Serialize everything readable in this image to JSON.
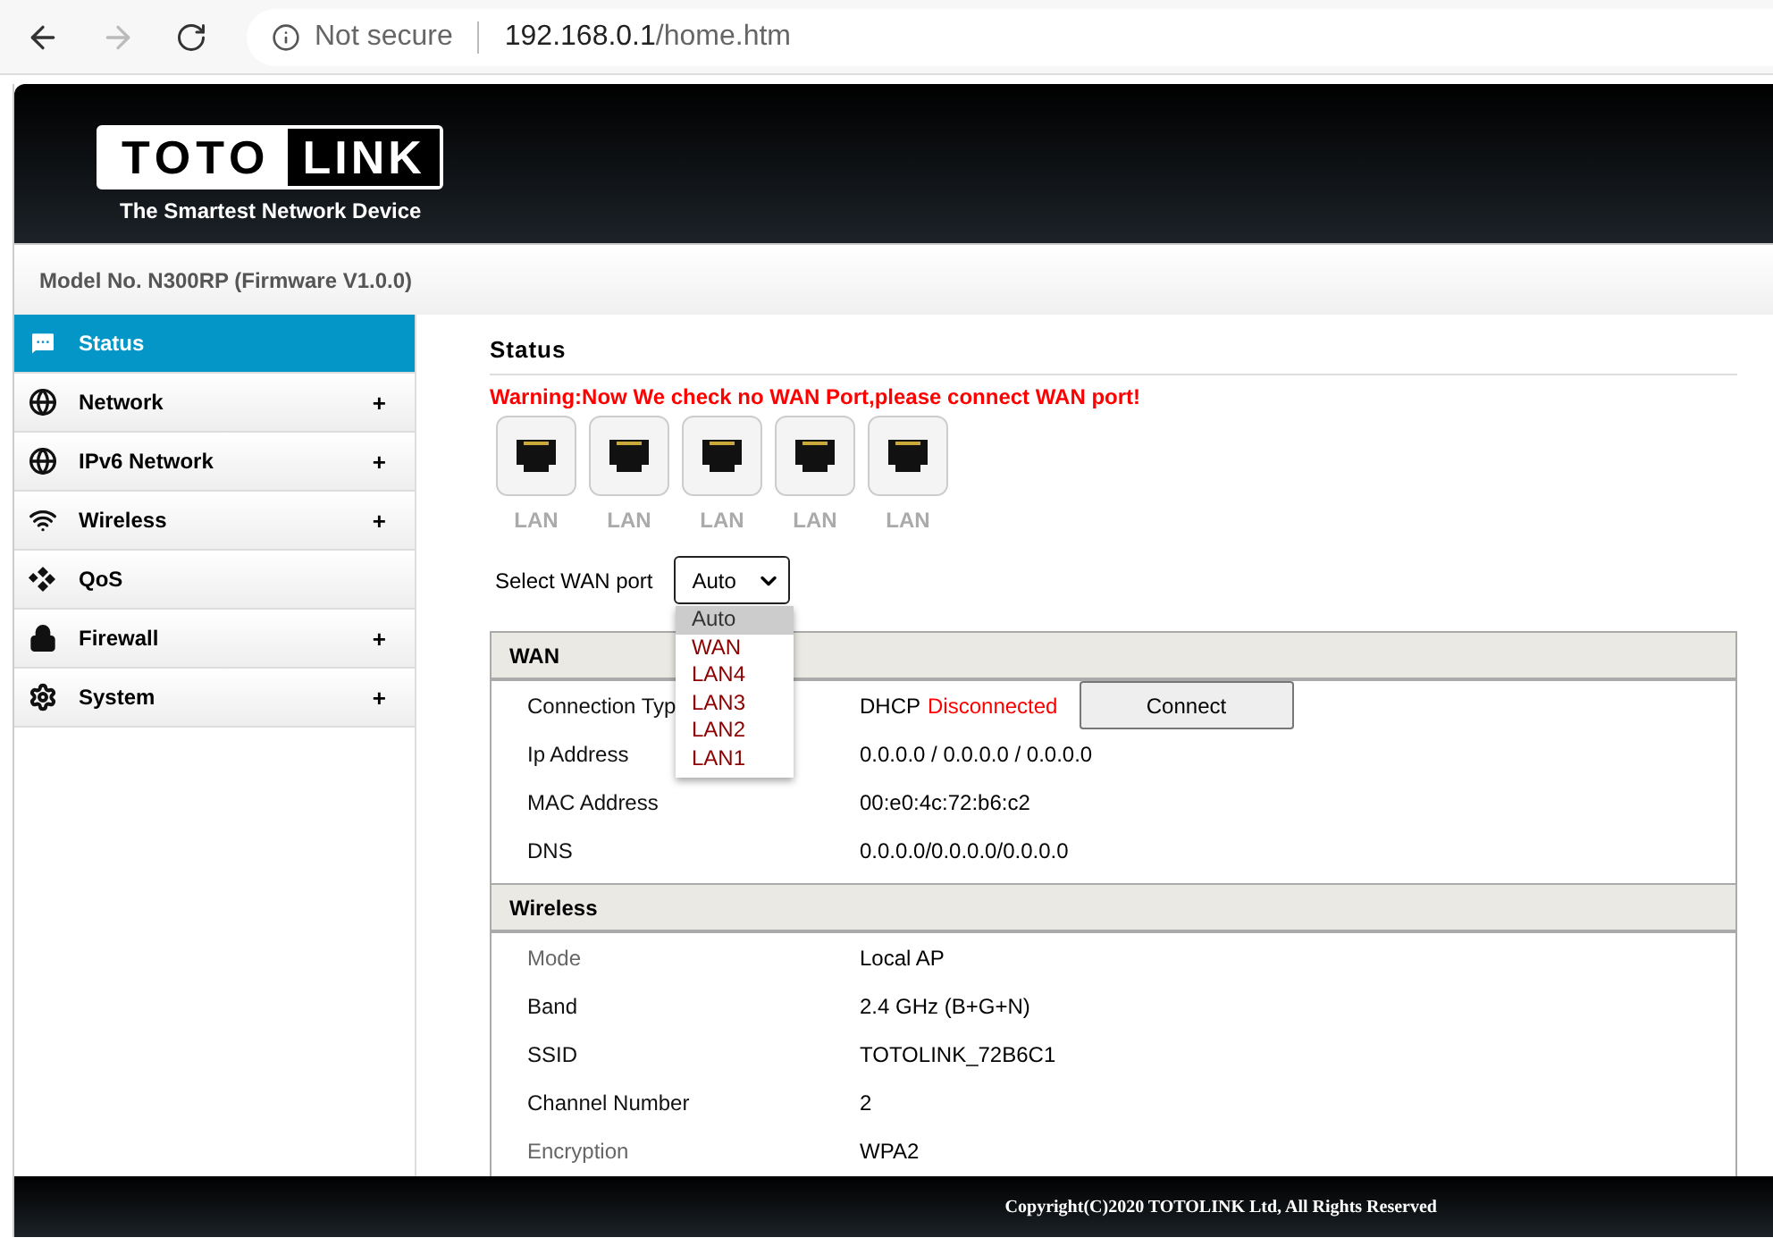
{
  "browser": {
    "security": "Not secure",
    "host": "192.168.0.1",
    "path": "/home.htm"
  },
  "header": {
    "logo_left": "TOTO",
    "logo_right": "LINK",
    "tagline": "The Smartest Network Device",
    "model": "Model No. N300RP (Firmware V1.0.0)"
  },
  "sidebar": {
    "items": [
      {
        "label": "Status",
        "kind": "chat",
        "selected": true
      },
      {
        "label": "Network",
        "kind": "globe",
        "expander": "+",
        "selected": false
      },
      {
        "label": "IPv6 Network",
        "kind": "globe",
        "expander": "+",
        "selected": false
      },
      {
        "label": "Wireless",
        "kind": "wifi",
        "expander": "+",
        "selected": false
      },
      {
        "label": "QoS",
        "kind": "qos",
        "selected": false
      },
      {
        "label": "Firewall",
        "kind": "lock",
        "expander": "+",
        "selected": false
      },
      {
        "label": "System",
        "kind": "gear",
        "expander": "+",
        "selected": false
      }
    ]
  },
  "content": {
    "title": "Status",
    "warning": "Warning:Now We check no WAN Port,please connect WAN port!",
    "ports": [
      {
        "label": "LAN"
      },
      {
        "label": "LAN"
      },
      {
        "label": "LAN"
      },
      {
        "label": "LAN"
      },
      {
        "label": "LAN"
      }
    ],
    "wan_select": {
      "label": "Select WAN port",
      "value": "Auto",
      "expanded": true,
      "options": [
        {
          "label": "Auto",
          "selected": true
        },
        {
          "label": "WAN",
          "selected": false
        },
        {
          "label": "LAN4",
          "selected": false
        },
        {
          "label": "LAN3",
          "selected": false
        },
        {
          "label": "LAN2",
          "selected": false
        },
        {
          "label": "LAN1",
          "selected": false
        }
      ]
    },
    "sections": [
      {
        "title": "WAN",
        "rows": [
          {
            "label": "Connection Typ",
            "value": "DHCP",
            "status": "Disconnected",
            "button": "Connect",
            "dimmed": false
          },
          {
            "label": "Ip Address",
            "value": "0.0.0.0 / 0.0.0.0 / 0.0.0.0",
            "dimmed": false
          },
          {
            "label": "MAC Address",
            "value": "00:e0:4c:72:b6:c2",
            "dimmed": false
          },
          {
            "label": "DNS",
            "value": "0.0.0.0/0.0.0.0/0.0.0.0",
            "dimmed": false
          }
        ]
      },
      {
        "title": "Wireless",
        "rows": [
          {
            "label": "Mode",
            "value": "Local AP",
            "dimmed": true
          },
          {
            "label": "Band",
            "value": "2.4 GHz (B+G+N)",
            "dimmed": false
          },
          {
            "label": "SSID",
            "value": "TOTOLINK_72B6C1",
            "dimmed": false
          },
          {
            "label": "Channel Number",
            "value": "2",
            "dimmed": false
          },
          {
            "label": "Encryption",
            "value": "WPA2",
            "dimmed": true
          }
        ]
      }
    ]
  },
  "footer": {
    "copyright": "Copyright(C)2020 TOTOLINK Ltd, All Rights Reserved"
  }
}
